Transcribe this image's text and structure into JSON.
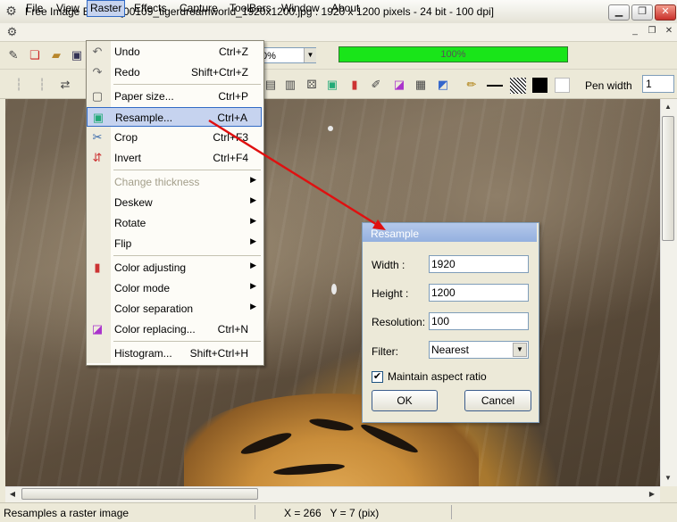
{
  "window": {
    "title": "Free Image Editor - [00109_tigerdreamworld_1920x1200.jpg : 1920 x 1200 pixels - 24 bit - 100 dpi]",
    "icon": "gear-icon",
    "caption_buttons": [
      "minimize",
      "restore",
      "close"
    ]
  },
  "menubar": {
    "items": [
      "File",
      "View",
      "Raster",
      "Effects",
      "Capture",
      "ToolBars",
      "Window",
      "About"
    ],
    "active": "Raster"
  },
  "toolbar": {
    "zoom_value": "0%",
    "progress_value": 100,
    "progress_label": "100%",
    "progress_color": "#19e519",
    "pen_width_label": "Pen width",
    "pen_width_value": "1",
    "swatch_colors": [
      "#000000",
      "#ffffff"
    ]
  },
  "raster_menu": {
    "items": [
      {
        "label": "Undo",
        "shortcut": "Ctrl+Z",
        "icon": "undo-icon"
      },
      {
        "label": "Redo",
        "shortcut": "Shift+Ctrl+Z",
        "icon": "redo-icon"
      },
      {
        "label": "Paper size...",
        "shortcut": "Ctrl+P",
        "icon": "paper-size-icon"
      },
      {
        "label": "Resample...",
        "shortcut": "Ctrl+A",
        "icon": "resample-icon",
        "highlighted": true
      },
      {
        "label": "Crop",
        "shortcut": "Ctrl+F3",
        "icon": "crop-icon"
      },
      {
        "label": "Invert",
        "shortcut": "Ctrl+F4",
        "icon": "invert-icon"
      },
      {
        "label": "Change thickness",
        "submenu": true,
        "disabled": true
      },
      {
        "label": "Deskew",
        "submenu": true
      },
      {
        "label": "Rotate",
        "submenu": true
      },
      {
        "label": "Flip",
        "submenu": true
      },
      {
        "label": "Color adjusting",
        "submenu": true,
        "icon": "color-adjust-icon"
      },
      {
        "label": "Color mode",
        "submenu": true
      },
      {
        "label": "Color separation",
        "submenu": true
      },
      {
        "label": "Color replacing...",
        "shortcut": "Ctrl+N",
        "icon": "color-replace-icon"
      },
      {
        "label": "Histogram...",
        "shortcut": "Shift+Ctrl+H"
      }
    ]
  },
  "resample_dialog": {
    "title": "Resample",
    "width_label": "Width :",
    "width_value": "1920",
    "height_label": "Height :",
    "height_value": "1200",
    "resolution_label": "Resolution:",
    "resolution_value": "100",
    "filter_label": "Filter:",
    "filter_value": "Nearest",
    "aspect_label": "Maintain aspect ratio",
    "aspect_checked": true,
    "ok_label": "OK",
    "cancel_label": "Cancel"
  },
  "statusbar": {
    "message": "Resamples a raster image",
    "coords": "X = 266   Y = 7 (pix)"
  },
  "annotation": {
    "arrow_color": "#e01010"
  }
}
